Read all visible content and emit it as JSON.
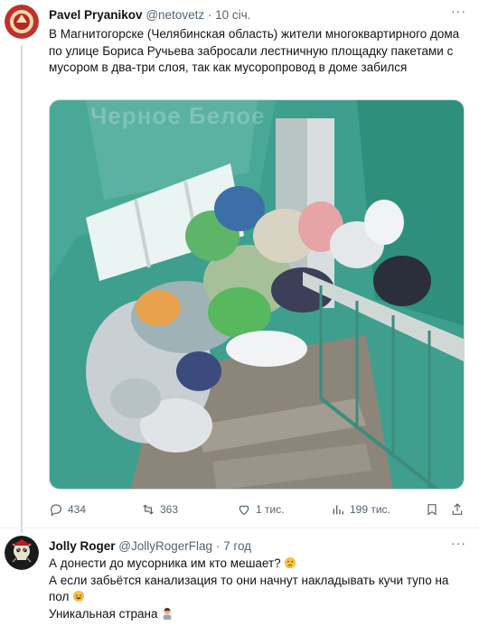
{
  "tweet1": {
    "author_name": "Pavel Pryanikov",
    "author_handle": "@netovetz",
    "separator": "·",
    "time": "10 січ.",
    "more": "···",
    "text": "В Магнитогорске (Челябинская область) жители многоквартирного дома по улице Бориса Ручьева забросали лестничную площадку пакетами с мусором в два-три слоя, так как мусоропровод в доме забился",
    "watermark": "Черное Белое",
    "actions": {
      "replies": "434",
      "retweets": "363",
      "likes": "1 тис.",
      "views": "199 тис."
    }
  },
  "tweet2": {
    "author_name": "Jolly Roger",
    "author_handle": "@JollyRogerFlag",
    "separator": "·",
    "time": "7 год",
    "more": "···",
    "line1": "А донести до мусорника им кто мешает?",
    "line2": "А если забьётся канализация то они начнут накладывать кучи тупо на пол",
    "line3": "Уникальная страна"
  },
  "icons": {
    "reply": "reply-icon",
    "retweet": "retweet-icon",
    "like": "heart-icon",
    "views": "views-icon",
    "share": "share-icon",
    "bookmark": "bookmark-icon",
    "more": "more-icon"
  },
  "colors": {
    "secondary_text": "#536471",
    "wall_teal": "#3f9f8e",
    "divider": "#eff3f4"
  }
}
